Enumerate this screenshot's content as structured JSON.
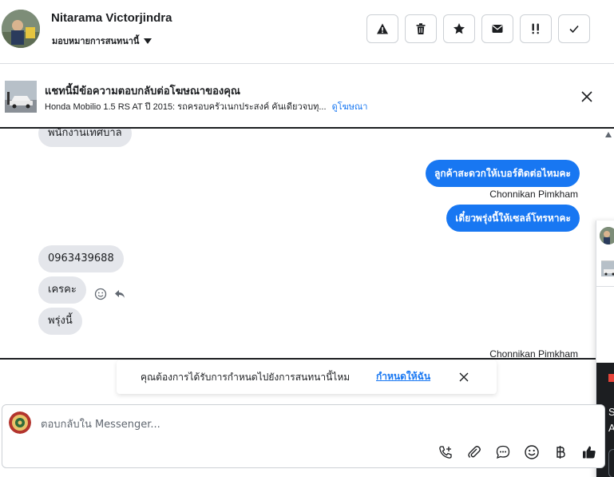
{
  "header": {
    "contact_name": "Nitarama Victorjindra",
    "assign_label": "มอบหมายการสนทนานี้",
    "actions": [
      {
        "name": "report-button",
        "icon": "warning-icon"
      },
      {
        "name": "delete-button",
        "icon": "trash-icon"
      },
      {
        "name": "star-button",
        "icon": "star-icon"
      },
      {
        "name": "mark-unread-button",
        "icon": "envelope-icon"
      },
      {
        "name": "follow-up-button",
        "icon": "exclamation-icon"
      },
      {
        "name": "mark-done-button",
        "icon": "check-icon"
      }
    ]
  },
  "ad_banner": {
    "title": "แชทนี้มีข้อความตอบกลับต่อโฆษณาของคุณ",
    "description": "Honda Mobilio 1.5 RS AT ปี 2015: รถครอบครัวเนกประสงค์ คันเดียวจบทุ...",
    "link_label": "ดูโฆษณา"
  },
  "thread": {
    "messages": [
      {
        "direction": "in",
        "text": "พนักงานเทศบาล"
      },
      {
        "direction": "out",
        "text": "ลูกค้าสะดวกให้เบอร์ติดต่อไหมคะ"
      },
      {
        "direction": "out",
        "text": "เดี๋ยวพรุ่งนี้ให้เซลล์โทรหาคะ"
      },
      {
        "direction": "in",
        "text": "0963439688"
      },
      {
        "direction": "in",
        "text": "เครคะ"
      },
      {
        "direction": "in",
        "text": "พรุ่งนี้"
      }
    ],
    "sender_1": "Chonnikan Pimkham",
    "sender_2": "Chonnikan Pimkham"
  },
  "side_panel": {
    "text": "S\nA"
  },
  "notice": {
    "text": "คุณต้องการได้รับการกำหนดไปยังการสนทนานี้ไหม",
    "link_label": "กำหนดให้ฉัน"
  },
  "composer": {
    "placeholder": "ตอบกลับใน Messenger..."
  },
  "colors": {
    "accent": "#1877f2",
    "incoming_bubble": "#e4e6eb",
    "text": "#1c1e21"
  }
}
